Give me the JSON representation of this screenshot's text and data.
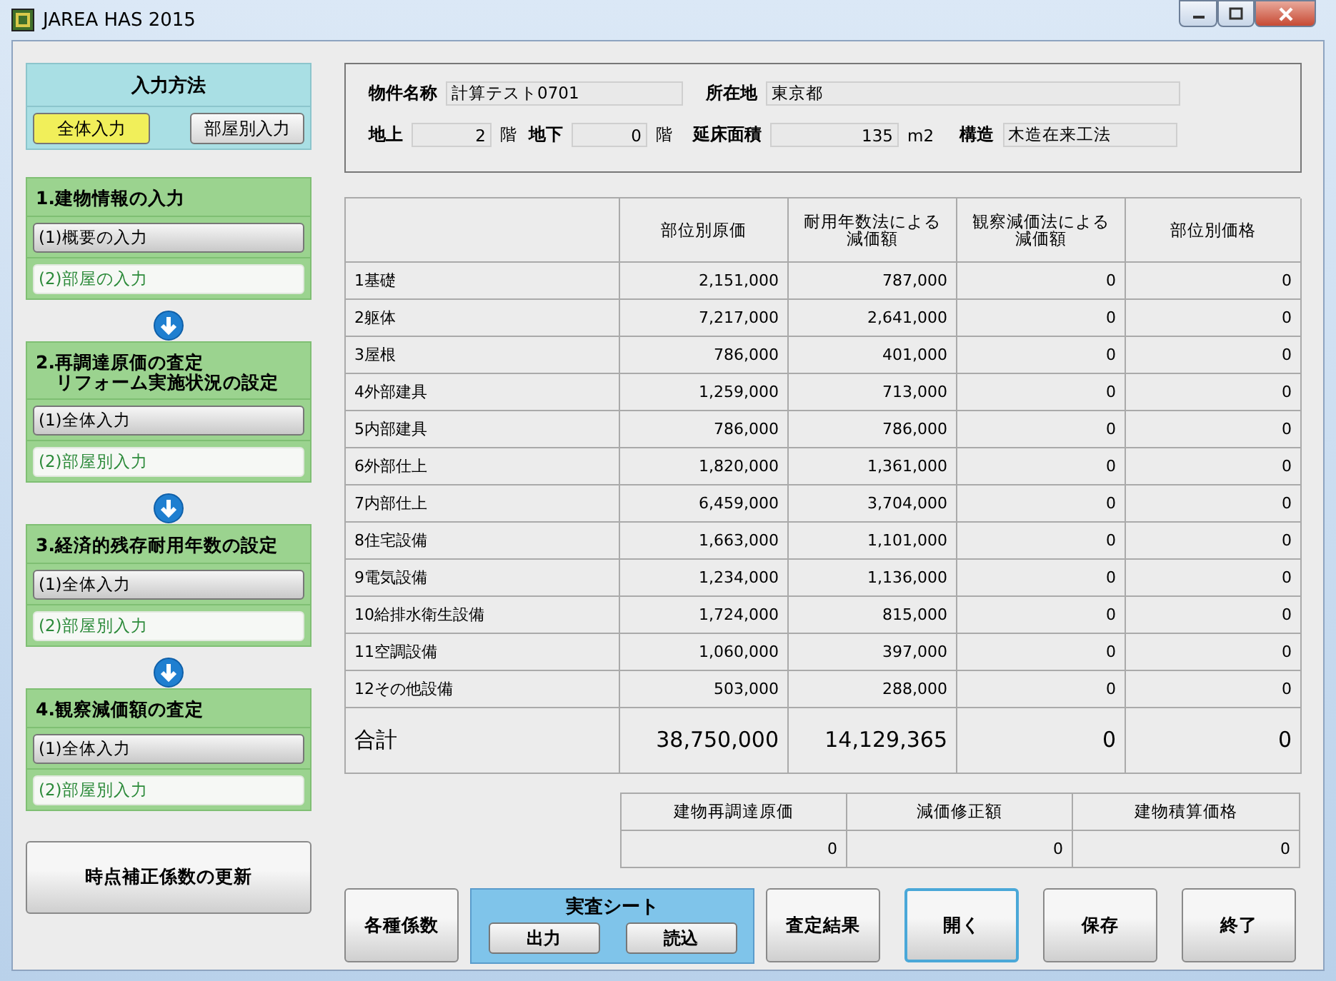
{
  "window": {
    "title": "JAREA HAS 2015"
  },
  "input_method": {
    "title": "入力方法",
    "options": [
      {
        "label": "全体入力",
        "selected": true
      },
      {
        "label": "部屋別入力",
        "selected": false
      }
    ]
  },
  "steps": [
    {
      "title": "1.建物情報の入力",
      "items": [
        {
          "label": "(1)概要の入力",
          "disabled": false
        },
        {
          "label": "(2)部屋の入力",
          "disabled": true
        }
      ]
    },
    {
      "title": "2.再調達原価の査定",
      "subtitle": "リフォーム実施状況の設定",
      "items": [
        {
          "label": "(1)全体入力",
          "disabled": false
        },
        {
          "label": "(2)部屋別入力",
          "disabled": true
        }
      ]
    },
    {
      "title": "3.経済的残存耐用年数の設定",
      "items": [
        {
          "label": "(1)全体入力",
          "disabled": false
        },
        {
          "label": "(2)部屋別入力",
          "disabled": true
        }
      ]
    },
    {
      "title": "4.観察減価額の査定",
      "items": [
        {
          "label": "(1)全体入力",
          "disabled": false
        },
        {
          "label": "(2)部屋別入力",
          "disabled": true
        }
      ]
    }
  ],
  "update_button": "時点補正係数の更新",
  "info": {
    "name": {
      "label": "物件名称",
      "value": "計算テスト0701"
    },
    "location": {
      "label": "所在地",
      "value": "東京都"
    },
    "floors_above": {
      "label": "地上",
      "value": "2",
      "unit": "階"
    },
    "floors_below": {
      "label": "地下",
      "value": "0",
      "unit": "階"
    },
    "floor_area": {
      "label": "延床面積",
      "value": "135",
      "unit": "m2"
    },
    "structure": {
      "label": "構造",
      "value": "木造在来工法"
    }
  },
  "table": {
    "columns": [
      "",
      "部位別原価",
      "耐用年数法による減価額",
      "観察減価法による減価額",
      "部位別価格"
    ],
    "rows": [
      [
        "1基礎",
        "2,151,000",
        "787,000",
        "0",
        "0"
      ],
      [
        "2躯体",
        "7,217,000",
        "2,641,000",
        "0",
        "0"
      ],
      [
        "3屋根",
        "786,000",
        "401,000",
        "0",
        "0"
      ],
      [
        "4外部建具",
        "1,259,000",
        "713,000",
        "0",
        "0"
      ],
      [
        "5内部建具",
        "786,000",
        "786,000",
        "0",
        "0"
      ],
      [
        "6外部仕上",
        "1,820,000",
        "1,361,000",
        "0",
        "0"
      ],
      [
        "7内部仕上",
        "6,459,000",
        "3,704,000",
        "0",
        "0"
      ],
      [
        "8住宅設備",
        "1,663,000",
        "1,101,000",
        "0",
        "0"
      ],
      [
        "9電気設備",
        "1,234,000",
        "1,136,000",
        "0",
        "0"
      ],
      [
        "10給排水衛生設備",
        "1,724,000",
        "815,000",
        "0",
        "0"
      ],
      [
        "11空調設備",
        "1,060,000",
        "397,000",
        "0",
        "0"
      ],
      [
        "12その他設備",
        "503,000",
        "288,000",
        "0",
        "0"
      ]
    ],
    "total": [
      "合計",
      "38,750,000",
      "14,129,365",
      "0",
      "0"
    ]
  },
  "summary": {
    "columns": [
      "建物再調達原価",
      "減価修正額",
      "建物積算価格"
    ],
    "values": [
      "0",
      "0",
      "0"
    ]
  },
  "sheet": {
    "title": "実査シート",
    "buttons": [
      "出力",
      "読込"
    ]
  },
  "buttons": [
    {
      "label": "各種係数",
      "focused": false
    },
    {
      "label": "査定結果",
      "focused": false
    },
    {
      "label": "開く",
      "focused": true
    },
    {
      "label": "保存",
      "focused": false
    },
    {
      "label": "終了",
      "focused": false
    }
  ]
}
